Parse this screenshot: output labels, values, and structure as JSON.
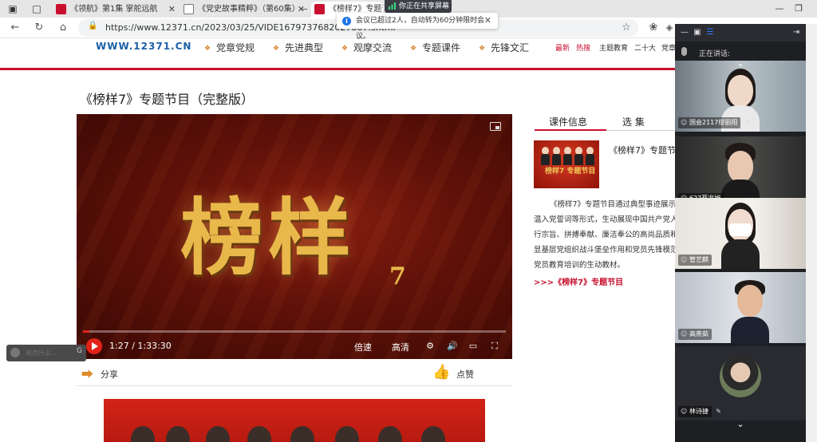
{
  "browser": {
    "tabs": [
      {
        "title": "《领航》第1集 掌舵远航",
        "active": false
      },
      {
        "title": "《党史故事精粹》（第60集）—",
        "active": false
      },
      {
        "title": "《榜样7》专题节目",
        "active": true
      }
    ],
    "url": "https://www.12371.cn/2023/03/25/VIDE1679737682027867.shtml"
  },
  "share_banner": {
    "label": "你正在共享屏幕",
    "notice": "会议已超过2人，自动转为60分钟限时会议。"
  },
  "site": {
    "logo": "WWW.12371.CN",
    "nav": [
      "党章党规",
      "先进典型",
      "观摩交流",
      "专题课件",
      "先锋文汇"
    ],
    "top_links": [
      {
        "label": "最新",
        "color": "#c8102e"
      },
      {
        "label": "热搜",
        "color": "#c8102e"
      },
      {
        "label": "主题教育",
        "color": "#333333"
      },
      {
        "label": "二十大",
        "color": "#333333"
      },
      {
        "label": "党章",
        "color": "#333333"
      }
    ]
  },
  "page": {
    "title": "《榜样7》专题节目（完整版）",
    "player": {
      "overlay_title": "榜样",
      "overlay_number": "7",
      "time": "1:27 / 1:33:30",
      "progress": 0.0155,
      "speed_label": "倍速",
      "quality_label": "高清"
    },
    "share_label": "分享",
    "like_label": "点赞"
  },
  "info_panel": {
    "tabs": [
      "课件信息",
      "选 集"
    ],
    "thumb_title": "榜样7 专题节目",
    "course_title": "《榜样7》专题节",
    "description_lines": [
      "《榜样7》专题节目通过典型事迹展示",
      "温入党誓词等形式，生动展现中国共产党人",
      "行宗旨、拼搏奉献、廉洁奉公的高尚品质和",
      "显基层党组织战斗堡垒作用和党员先锋模范",
      "党员教育培训的生动教材。"
    ],
    "more_link": ">>>《榜样7》专题节目"
  },
  "chat": {
    "placeholder": "说点什么...",
    "extra": "G"
  },
  "meeting": {
    "speaking_label": "正在讲话:",
    "participants": [
      {
        "name": "国会2117缪丽阳"
      },
      {
        "name": "627蔡兆旭"
      },
      {
        "name": "管艺麒"
      },
      {
        "name": "高燕茹"
      },
      {
        "name": "林诗捷"
      }
    ]
  },
  "colors": {
    "brand_red": "#c8102e",
    "accent_orange": "#e08a2a",
    "logo_blue": "#1b5fa8"
  }
}
